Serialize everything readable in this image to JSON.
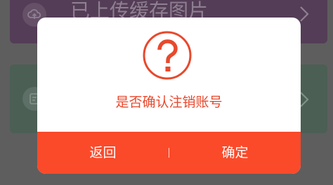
{
  "background": {
    "items": [
      {
        "label": "已上传缓存图片",
        "icon": "cloud-upload-icon"
      },
      {
        "label": "",
        "icon": "document-icon"
      }
    ]
  },
  "dialog": {
    "icon": "question-circle-icon",
    "message": "是否确认注销账号",
    "cancel_label": "返回",
    "confirm_label": "确定"
  },
  "colors": {
    "accent": "#fb4a2a",
    "message_text": "#e8492d",
    "dialog_bg": "#ffffff",
    "overlay": "#5e5e5e"
  }
}
